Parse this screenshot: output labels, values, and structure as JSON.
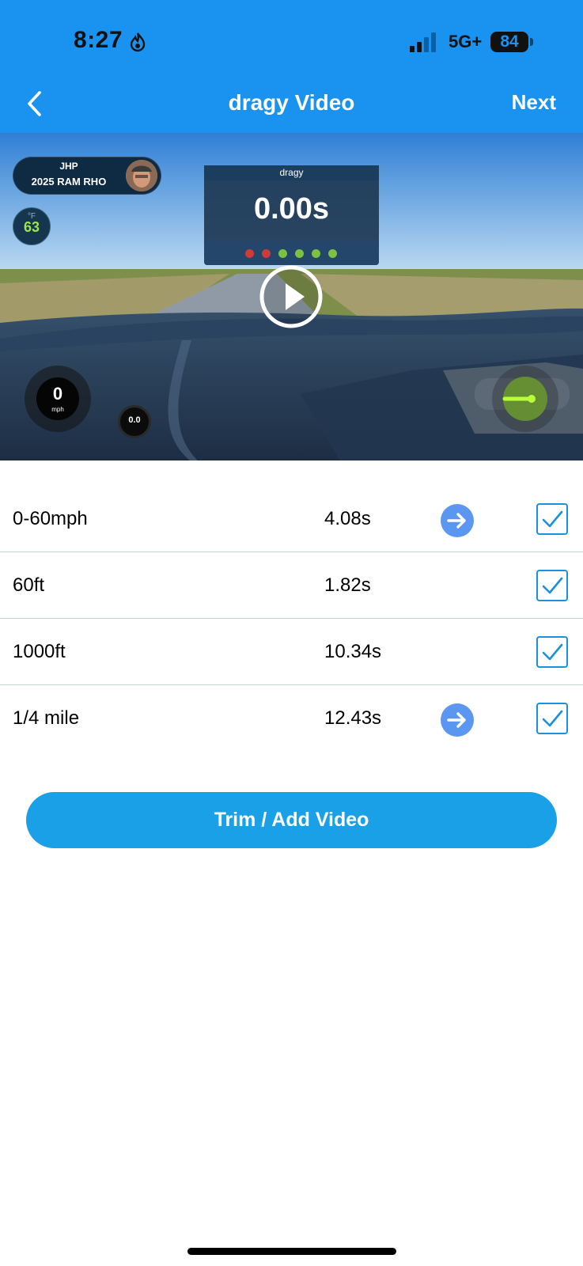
{
  "status_bar": {
    "time": "8:27",
    "network": "5G+",
    "battery": "84"
  },
  "nav": {
    "title": "dragy Video",
    "next_label": "Next"
  },
  "video": {
    "profile_name": "JHP",
    "profile_car": "2025 RAM RHO",
    "temperature_unit": "°F",
    "temperature": "63",
    "timer_brand": "dragy",
    "timer_value": "0.00s",
    "speed": "0",
    "speed_unit": "mph",
    "gforce": "0.0",
    "start_lights": [
      "#d23a3a",
      "#d23a3a",
      "#7bc142",
      "#7bc142",
      "#7bc142",
      "#7bc142"
    ]
  },
  "results": [
    {
      "label": "0-60mph",
      "time": "4.08s",
      "has_arrow": true,
      "checked": true
    },
    {
      "label": "60ft",
      "time": "1.82s",
      "has_arrow": false,
      "checked": true
    },
    {
      "label": "1000ft",
      "time": "10.34s",
      "has_arrow": false,
      "checked": true
    },
    {
      "label": "1/4 mile",
      "time": "12.43s",
      "has_arrow": true,
      "checked": true
    }
  ],
  "trim_button_label": "Trim / Add Video",
  "colors": {
    "header": "#1a92ef",
    "button": "#1aa0e6",
    "arrow": "#5b97f0",
    "check": "#1b8fe0"
  }
}
